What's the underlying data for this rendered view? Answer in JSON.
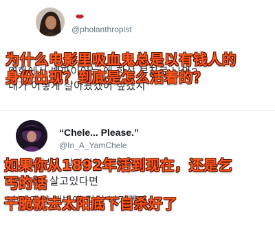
{
  "tweets": [
    {
      "handle": "@pholanthropist",
      "korean_lines": [
        "영화에서 뱀파이어는 왜 항상 부자로 나와?",
        "내가 어떻게 살아왔겠어 싶겠지"
      ]
    },
    {
      "display_name": "“Chele... Please.”",
      "handle": "@In_A_YamChele",
      "korean_lines": [
        "1892년부터 살아왔는데 아직",
        "가난하게 살고있다면",
        "나는 그냥 햇빛에 걸어 나가겠다"
      ]
    }
  ],
  "captions": {
    "top": [
      "为什么电影里吸血鬼总是以有钱人的",
      "身份出现？到底是怎么活着的？"
    ],
    "bottom": [
      "如果你从1892年活到现在，还是乞",
      "丐的话",
      "干脆就去太阳底下自杀好了"
    ]
  },
  "colors": {
    "caption_fill": "#ff5a1f",
    "caption_outline": "#5a0f00",
    "handle": "#657786"
  },
  "icons": {
    "tweet1_name_badge": "lips-icon"
  }
}
